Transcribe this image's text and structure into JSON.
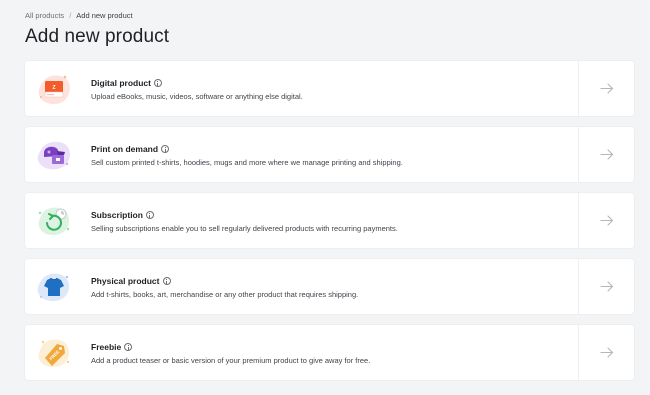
{
  "breadcrumb": {
    "parent": "All products",
    "separator": "/",
    "current": "Add new product"
  },
  "page": {
    "title": "Add new product"
  },
  "products": [
    {
      "title": "Digital product",
      "description": "Upload eBooks, music, videos, software or anything else digital.",
      "icon": "digital-product-icon",
      "icon_label": "Z",
      "accent": "#f25c2a",
      "blob": "#fde3dc"
    },
    {
      "title": "Print on demand",
      "description": "Sell custom printed t-shirts, hoodies, mugs and more where we manage printing and shipping.",
      "icon": "print-on-demand-icon",
      "accent": "#7b3fc1",
      "blob": "#ebe0f7"
    },
    {
      "title": "Subscription",
      "description": "Selling subscriptions enable you to sell regularly delivered products with recurring payments.",
      "icon": "subscription-icon",
      "accent": "#2fb05a",
      "blob": "#dcf3e3"
    },
    {
      "title": "Physical product",
      "description": "Add t-shirts, books, art, merchandise or any other product that requires shipping.",
      "icon": "physical-product-icon",
      "accent": "#1f6fc4",
      "blob": "#dde9f8"
    },
    {
      "title": "Freebie",
      "description": "Add a product teaser or basic version of your premium product to give away for free.",
      "icon": "freebie-icon",
      "icon_label": "FREE",
      "accent": "#f2a73b",
      "blob": "#fdeed6"
    }
  ]
}
